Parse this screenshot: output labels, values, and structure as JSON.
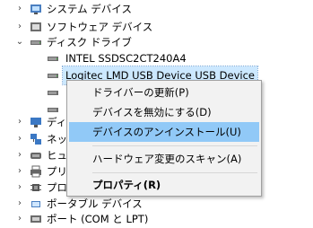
{
  "tree": {
    "items": [
      {
        "label": "システム デバイス",
        "icon": "system-devices-icon"
      },
      {
        "label": "ソフトウェア デバイス",
        "icon": "software-devices-icon"
      },
      {
        "label": "ディスク ドライブ",
        "icon": "disk-drive-icon"
      },
      {
        "label": "INTEL SSDSC2CT240A4",
        "icon": "disk-drive-icon"
      },
      {
        "label": "Logitec LMD USB Device USB Device",
        "icon": "disk-drive-icon"
      },
      {
        "label": "ディ",
        "icon": "display-adapter-icon"
      },
      {
        "label": "ネッ",
        "icon": "network-adapter-icon"
      },
      {
        "label": "ヒュ",
        "icon": "hid-icon"
      },
      {
        "label": "プリ",
        "icon": "print-queue-icon"
      },
      {
        "label": "プロ",
        "icon": "processor-icon"
      },
      {
        "label": "ポータブル デバイス",
        "icon": "portable-device-icon"
      },
      {
        "label": "ポート (COM と LPT)",
        "icon": "port-icon"
      }
    ]
  },
  "context_menu": {
    "items": [
      {
        "label": "ドライバーの更新(P)"
      },
      {
        "label": "デバイスを無効にする(D)"
      },
      {
        "label": "デバイスのアンインストール(U)",
        "highlighted": true
      },
      {
        "label": "ハードウェア変更のスキャン(A)"
      },
      {
        "label": "プロパティ(R)",
        "bold": true
      }
    ]
  },
  "colors": {
    "menu_highlight": "#91c9f7",
    "selection": "#cce8ff"
  }
}
